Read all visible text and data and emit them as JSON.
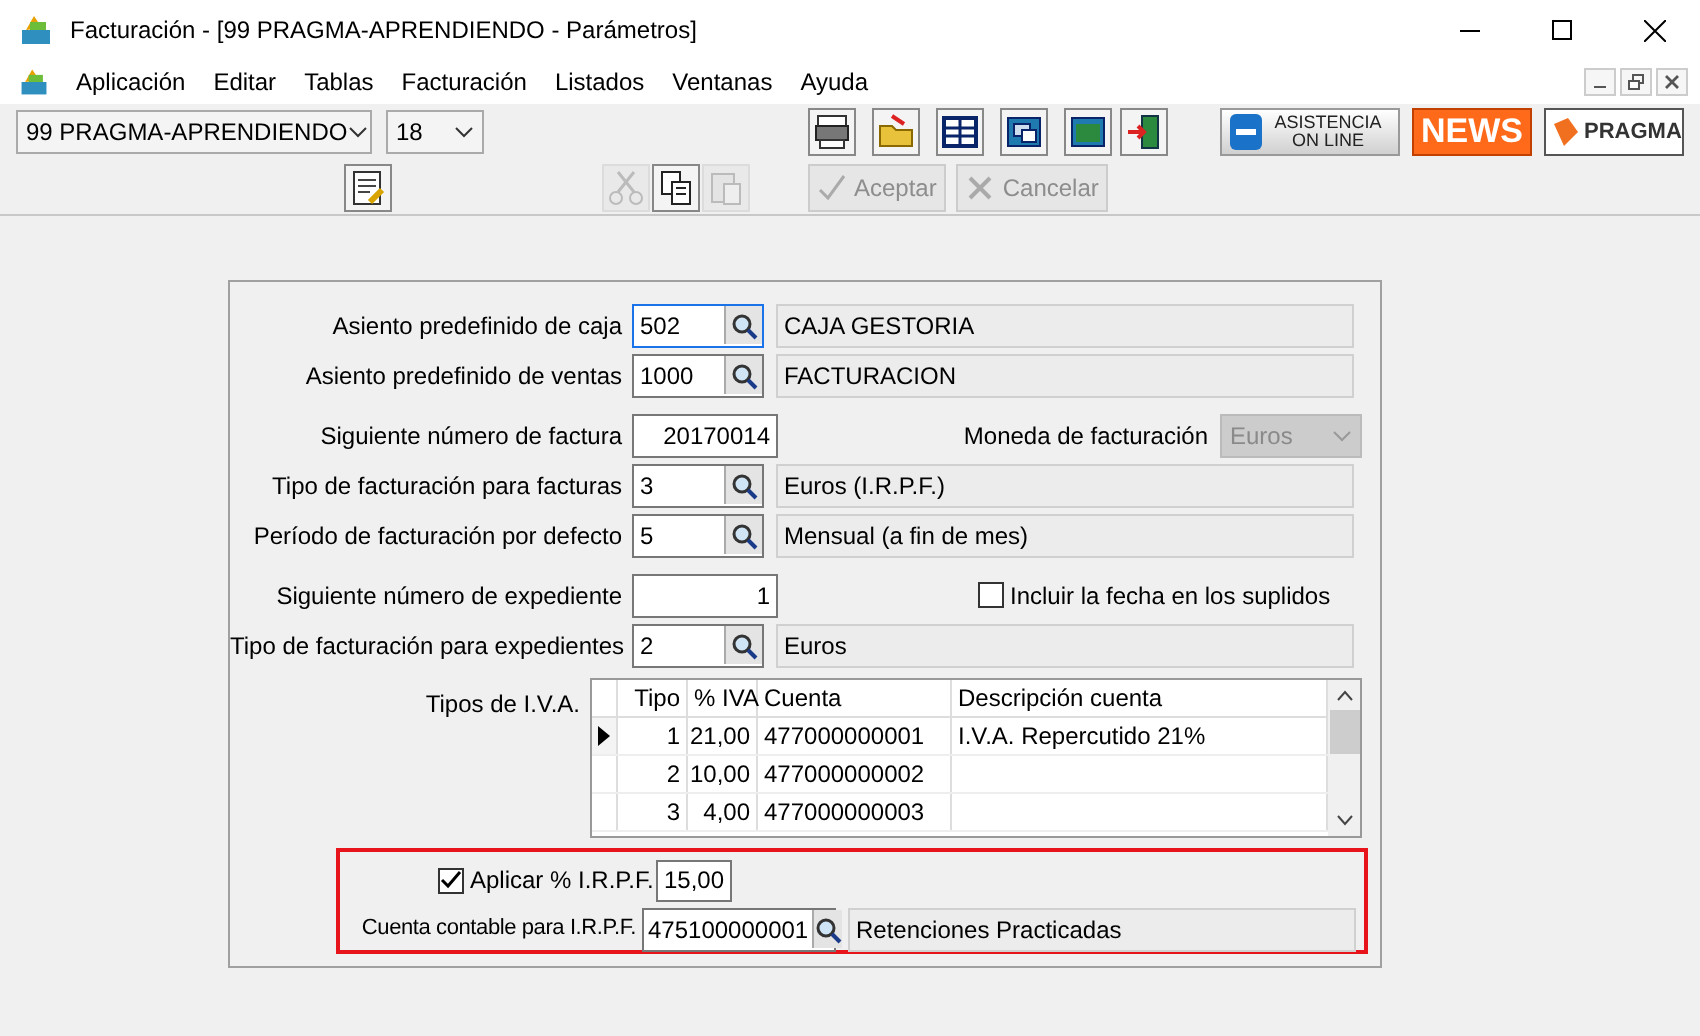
{
  "window": {
    "title": "Facturación - [99  PRAGMA-APRENDIENDO  -  Parámetros]"
  },
  "menu": [
    "Aplicación",
    "Editar",
    "Tablas",
    "Facturación",
    "Listados",
    "Ventanas",
    "Ayuda"
  ],
  "toolbar": {
    "company": "99  PRAGMA-APRENDIENDO",
    "period": "18",
    "tools": [
      {
        "kind": "printer"
      },
      {
        "kind": "folder"
      },
      {
        "kind": "grid"
      },
      {
        "kind": "windows"
      },
      {
        "kind": "window"
      },
      {
        "kind": "exit"
      }
    ],
    "brands": [
      {
        "kind": "support",
        "label": "ASISTENCIA ON LINE"
      },
      {
        "kind": "news",
        "label": "NEWS"
      },
      {
        "kind": "pragma",
        "label": "PRAGMA"
      }
    ]
  },
  "actions": {
    "tools": [
      {
        "kind": "notes",
        "disabled": false
      },
      {
        "kind": "cut",
        "disabled": true
      },
      {
        "kind": "copy",
        "disabled": false
      },
      {
        "kind": "paste",
        "disabled": true
      }
    ],
    "buttons": [
      {
        "kind": "ok",
        "label": "Aceptar",
        "disabled": true
      },
      {
        "kind": "cancel",
        "label": "Cancelar",
        "disabled": true
      }
    ]
  },
  "groups": [
    [
      {
        "kind": "lookup",
        "label": "Asiento predefinido de caja",
        "value": "502",
        "description": "CAJA GESTORIA",
        "focused": true
      },
      {
        "kind": "lookup",
        "label": "Asiento predefinido de ventas",
        "value": "1000",
        "description": "FACTURACION",
        "focused": false
      }
    ],
    [
      {
        "kind": "number",
        "label": "Siguiente número de factura",
        "value": "20170014",
        "side": {
          "kind": "select",
          "label": "Moneda de facturación",
          "value": "Euros",
          "disabled": true
        }
      },
      {
        "kind": "lookup",
        "label": "Tipo de facturación para facturas",
        "value": "3",
        "description": "Euros (I.R.P.F.)",
        "focused": false
      },
      {
        "kind": "lookup",
        "label": "Período de facturación por defecto",
        "value": "5",
        "description": "Mensual (a fin de mes)",
        "focused": false
      }
    ],
    [
      {
        "kind": "number",
        "label": "Siguiente número de expediente",
        "value": "1",
        "side": {
          "kind": "checkbox",
          "label": "Incluir la fecha en los suplidos",
          "checked": false
        }
      },
      {
        "kind": "lookup",
        "label": "Tipo de facturación para expedientes",
        "value": "2",
        "description": "Euros",
        "focused": false
      }
    ]
  ],
  "iva": {
    "label": "Tipos de I.V.A.",
    "columns": [
      "Tipo",
      "% IVA",
      "Cuenta",
      "Descripción cuenta"
    ],
    "rows": [
      {
        "cells": [
          "1",
          "21,00",
          "477000000001",
          "I.V.A. Repercutido 21%"
        ],
        "selected": true
      },
      {
        "cells": [
          "2",
          "10,00",
          "477000000002",
          ""
        ],
        "selected": false
      },
      {
        "cells": [
          "3",
          "4,00",
          "477000000003",
          ""
        ],
        "selected": false
      }
    ]
  },
  "irpf": {
    "apply": {
      "label": "Aplicar % I.R.P.F.",
      "checked": true,
      "value": "15,00"
    },
    "account": {
      "label": "Cuenta contable para I.R.P.F.",
      "value": "475100000001",
      "description": "Retenciones Practicadas"
    }
  }
}
